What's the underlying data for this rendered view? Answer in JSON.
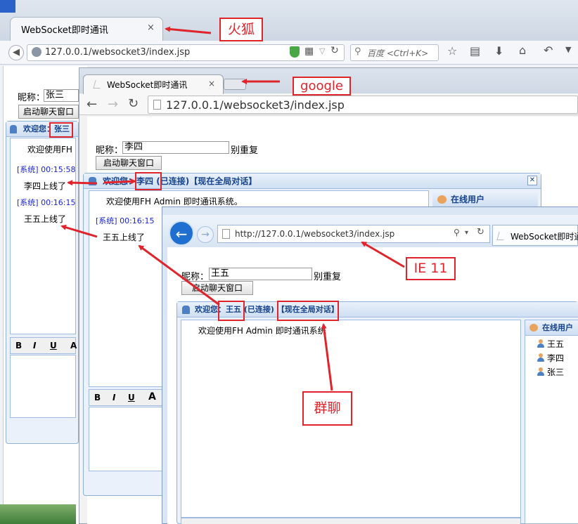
{
  "firefox": {
    "tab_title": "WebSocket即时通讯",
    "close": "×",
    "url": "127.0.0.1/websocket3/index.jsp",
    "search_placeholder": "百度 <Ctrl+K>",
    "nick_label": "昵称：",
    "nick_value": "张三",
    "start_button": "启动聊天窗口",
    "welcome": "欢迎您：",
    "user": "张三",
    "welcome_msg": "欢迎使用FH",
    "sys1": "[系统] 00:15:58",
    "msg1": "李四上线了",
    "sys2": "[系统] 00:16:15",
    "msg2": "王五上线了",
    "toolbar": [
      "B",
      "I",
      "U",
      "A"
    ]
  },
  "chrome": {
    "tab_title": "WebSocket即时通讯",
    "close": "×",
    "url": "127.0.0.1/websocket3/index.jsp",
    "nick_label": "昵称：",
    "nick_value": "李四",
    "nick_suffix": "别重复",
    "start_button": "启动聊天窗口",
    "welcome": "欢迎您：",
    "user": "李四",
    "status": "(已连接)",
    "global": "【现在全局对话】",
    "welcome_msg": "欢迎使用FH Admin 即时通讯系统。",
    "online_title": "在线用户",
    "sys1": "[系统] 00:16:15",
    "msg1": "王五上线了",
    "toolbar": [
      "B",
      "I",
      "U",
      "A"
    ],
    "close_icon": "✕"
  },
  "ie": {
    "url": "http://127.0.0.1/websocket3/index.jsp",
    "tab_title": "WebSocket即时通讯",
    "nick_label": "昵称：",
    "nick_value": "王五",
    "nick_suffix": "别重复",
    "start_button": "启动聊天窗口",
    "welcome": "欢迎您：",
    "user": "王五",
    "status": "(已连接)",
    "global": "【现在全局对话】",
    "welcome_msg": "欢迎使用FH Admin 即时通讯系统",
    "online_title": "在线用户",
    "online_users": [
      "王五",
      "李四",
      "张三"
    ]
  },
  "annotations": {
    "firefox": "火狐",
    "google": "google",
    "ie": "IE 11",
    "group": "群聊"
  },
  "colors": {
    "annotation_red": "#e0242c",
    "link_blue": "#15428b",
    "system_blue": "#1a25d6"
  }
}
